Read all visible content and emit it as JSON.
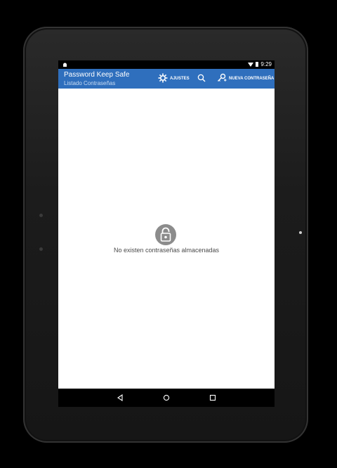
{
  "status_bar": {
    "time": "9:29"
  },
  "action_bar": {
    "title": "Password Keep Safe",
    "subtitle": "Listado Contraseñas",
    "settings_label": "AJUSTES",
    "new_password_label": "NUEVA CONTRASEÑA",
    "background_color": "#2f6fbd"
  },
  "empty_state": {
    "message": "No existen contraseñas almacenadas",
    "icon": "lock-icon"
  },
  "navigation_bar": {
    "buttons": [
      "back-icon",
      "home-icon",
      "recents-icon"
    ]
  }
}
